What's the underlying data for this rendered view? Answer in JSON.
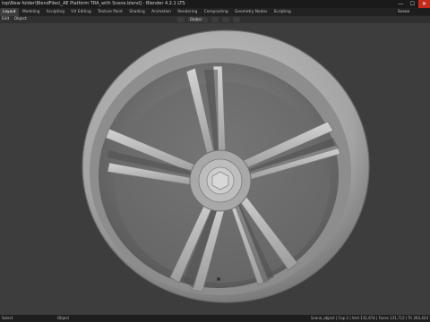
{
  "window": {
    "title": "top\\New folder\\BlendFiles\\_AE Platform TRA_with Scene.blend] - Blender 4.2.1 LTS",
    "minimize_glyph": "—",
    "maximize_glyph": "☐",
    "close_glyph": "✕"
  },
  "workspaces": {
    "tabs": [
      "Layout",
      "Modeling",
      "Sculpting",
      "UV Editing",
      "Texture Paint",
      "Shading",
      "Animation",
      "Rendering",
      "Compositing",
      "Geometry Nodes",
      "Scripting"
    ],
    "active": "Layout",
    "scene_label": "Scene"
  },
  "viewport_header": {
    "menus": [
      "Edit",
      "Object"
    ],
    "transform_orientation": "Global"
  },
  "status_bar": {
    "left": "Select",
    "mid": "Object",
    "right": "Scene_object | Cap 2 | Vert 131,674 | Faces 131,712 | Tri 263,424"
  },
  "colors": {
    "viewport_bg": "#3d3d3d",
    "wheel_light": "#b9b9b9",
    "wheel_dark": "#5e5e5e",
    "close_button": "#c42b1c"
  }
}
